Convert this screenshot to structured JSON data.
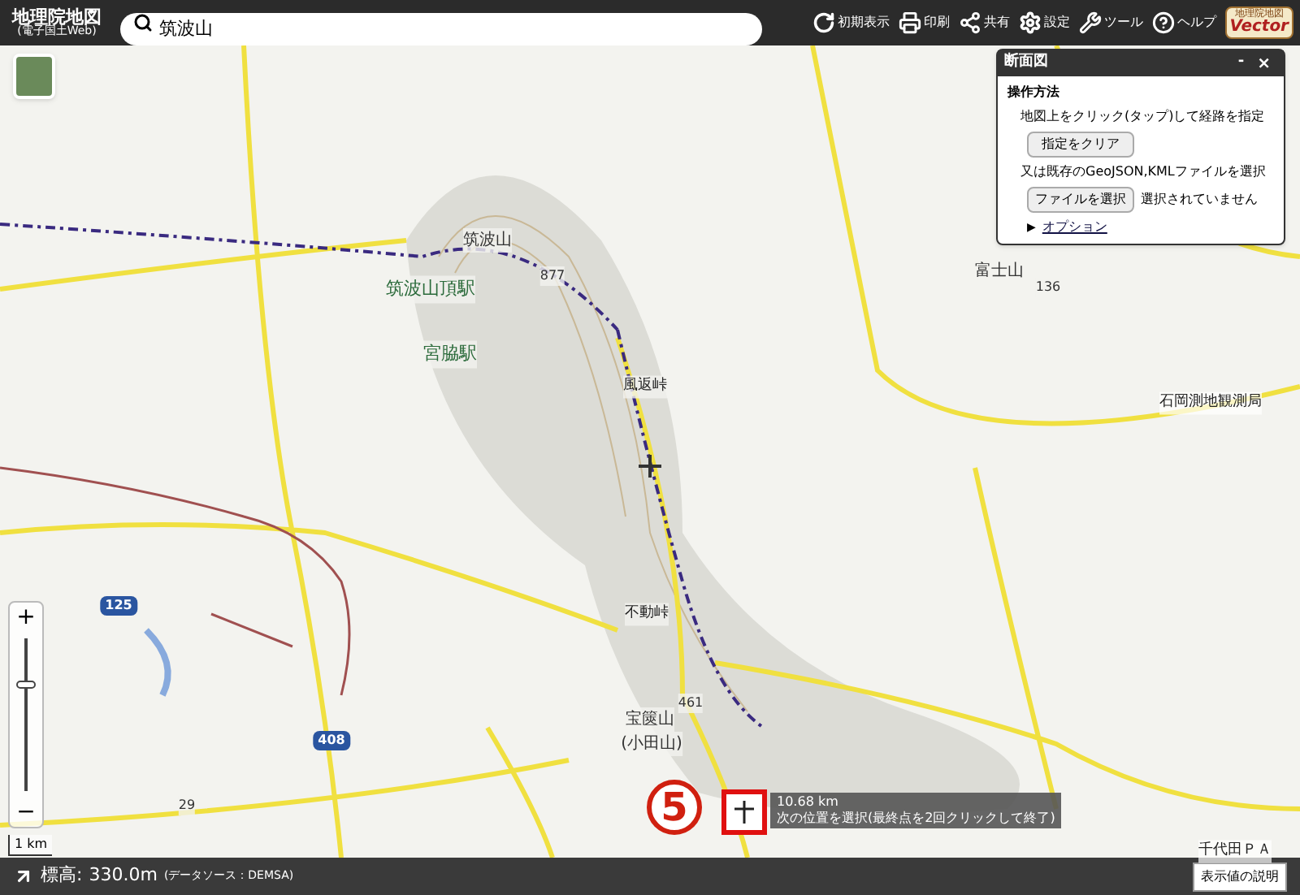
{
  "header": {
    "title": "地理院地図",
    "subtitle": "(電子国土Web)",
    "search": {
      "value": "筑波山"
    },
    "tools": [
      {
        "kind": "reload",
        "label": "初期表示"
      },
      {
        "kind": "print",
        "label": "印刷"
      },
      {
        "kind": "share",
        "label": "共有"
      },
      {
        "kind": "settings",
        "label": "設定"
      },
      {
        "kind": "tool",
        "label": "ツール"
      },
      {
        "kind": "help",
        "label": "ヘルプ"
      }
    ],
    "vector_badge": {
      "line1": "地理院地図",
      "line2": "Vector"
    }
  },
  "map": {
    "labels": [
      {
        "kind": "peak",
        "text": "筑波山"
      },
      {
        "kind": "height",
        "text": "877"
      },
      {
        "kind": "station",
        "text": "筑波山頂駅"
      },
      {
        "kind": "station",
        "text": "宮脇駅"
      },
      {
        "kind": "pass",
        "text": "風返峠"
      },
      {
        "kind": "pass",
        "text": "不動峠"
      },
      {
        "kind": "height",
        "text": "461"
      },
      {
        "kind": "peak",
        "text": "宝篋山"
      },
      {
        "kind": "peak",
        "text": "(小田山)"
      },
      {
        "kind": "peak",
        "text": "富士山"
      },
      {
        "kind": "height",
        "text": "136"
      },
      {
        "kind": "place",
        "text": "石岡測地観測局"
      },
      {
        "kind": "height",
        "text": "29"
      },
      {
        "kind": "road",
        "text": "125"
      },
      {
        "kind": "road",
        "text": "408"
      },
      {
        "kind": "place",
        "text": "千代田ＰＡ"
      }
    ],
    "zoom": {
      "plus": "+",
      "minus": "−",
      "level": 0.7
    },
    "scale": "1 km"
  },
  "profile_panel": {
    "title": "断面図",
    "minimize": "-",
    "close": "×",
    "heading": "操作方法",
    "instruction": "地図上をクリック(タップ)して経路を指定",
    "clear_button": "指定をクリア",
    "file_text": "又は既存のGeoJSON,KMLファイルを選択",
    "file_button": "ファイルを選択",
    "file_status": "選択されていません",
    "options": {
      "marker": "▶",
      "label": "オプション",
      "expanded": false
    }
  },
  "tooltip": {
    "distance": "10.68 km",
    "instruction": "次の位置を選択(最終点を2回クリックして終了)"
  },
  "step_marker": "5",
  "status_bar": {
    "label": "標高:",
    "value": "330.0m",
    "source": "(データソース：DEMSA)",
    "help_button": "表示値の説明"
  }
}
